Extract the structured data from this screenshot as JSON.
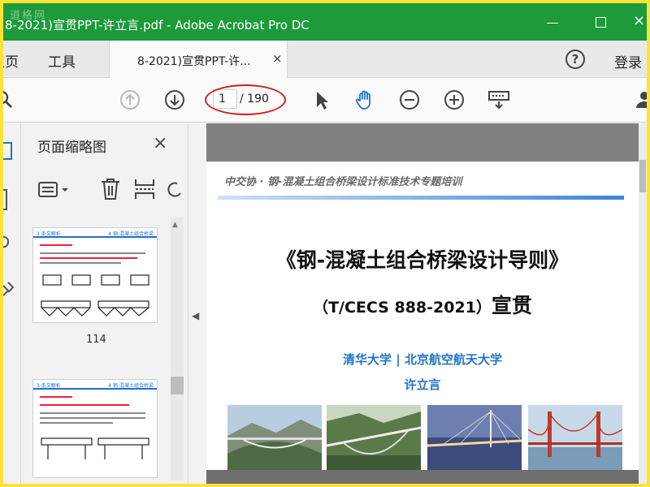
{
  "titlebar": {
    "title": "8-2021)宣贯PPT-许立言.pdf - Adobe Acrobat Pro DC",
    "watermark": "道格网",
    "close_glyph": "×"
  },
  "menubar": {
    "home_label": "主页",
    "tools_label": "工具",
    "tab_label": "8-2021)宣贯PPT-许...",
    "tab_close": "×",
    "help_glyph": "?",
    "login_label": "登录"
  },
  "toolbar": {
    "page_current": "1",
    "page_total": "/ 190"
  },
  "thumbnails": {
    "pane_title": "页面缩略图",
    "close_glyph": "×",
    "items": [
      {
        "header_left": "3 条文解析",
        "header_right": "4 钢-混凝土组合桥梁",
        "page_number": "114"
      },
      {
        "header_left": "3 条文解析",
        "header_right": "4 钢-混凝土组合桥梁",
        "page_number": ""
      }
    ]
  },
  "document": {
    "header": "中交协 · 钢-混凝土组合桥梁设计标准技术专题培训",
    "title": "《钢-混凝土组合桥梁设计导则》",
    "subtitle_code": "（T/CECS 888-2021）",
    "subtitle_word": "宣贯",
    "organizations": "清华大学 | 北京航空航天大学",
    "author": "许立言"
  },
  "colors": {
    "titlebar": "#1d9b3a",
    "accent_blue": "#1f74c8",
    "annotation_red": "#d21d1d",
    "frame_yellow": "#ffe23a"
  },
  "icons": [
    "search-icon",
    "previous-page-icon",
    "next-page-icon",
    "select-cursor-icon",
    "hand-tool-icon",
    "zoom-out-icon",
    "zoom-in-icon",
    "keyboard-icon",
    "user-icon",
    "options-icon",
    "delete-icon",
    "insert-page-icon",
    "rotate-icon"
  ]
}
